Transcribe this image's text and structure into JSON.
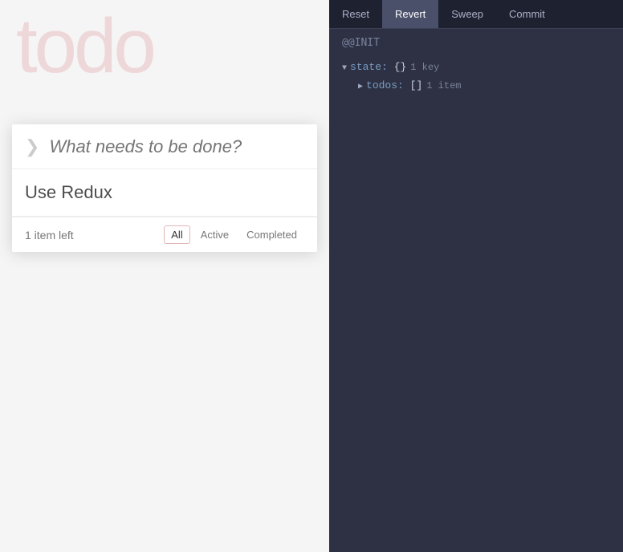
{
  "left": {
    "app_title": "todo",
    "input_placeholder": "What needs to be done?",
    "todos": [
      {
        "text": "Use Redux",
        "completed": false
      }
    ],
    "footer": {
      "count_label": "1 item left",
      "filters": [
        {
          "label": "All",
          "active": true
        },
        {
          "label": "Active",
          "active": false
        },
        {
          "label": "Completed",
          "active": false
        }
      ]
    }
  },
  "right": {
    "toolbar": {
      "buttons": [
        {
          "label": "Reset",
          "selected": false
        },
        {
          "label": "Revert",
          "selected": true
        },
        {
          "label": "Sweep",
          "selected": false
        },
        {
          "label": "Commit",
          "selected": false
        }
      ]
    },
    "section_title": "@@INIT",
    "tree": {
      "root_key": "state:",
      "root_bracket_open": "{}",
      "root_meta": "1 key",
      "children": [
        {
          "key": "todos:",
          "bracket_open": "[]",
          "meta": "1 item"
        }
      ]
    }
  }
}
